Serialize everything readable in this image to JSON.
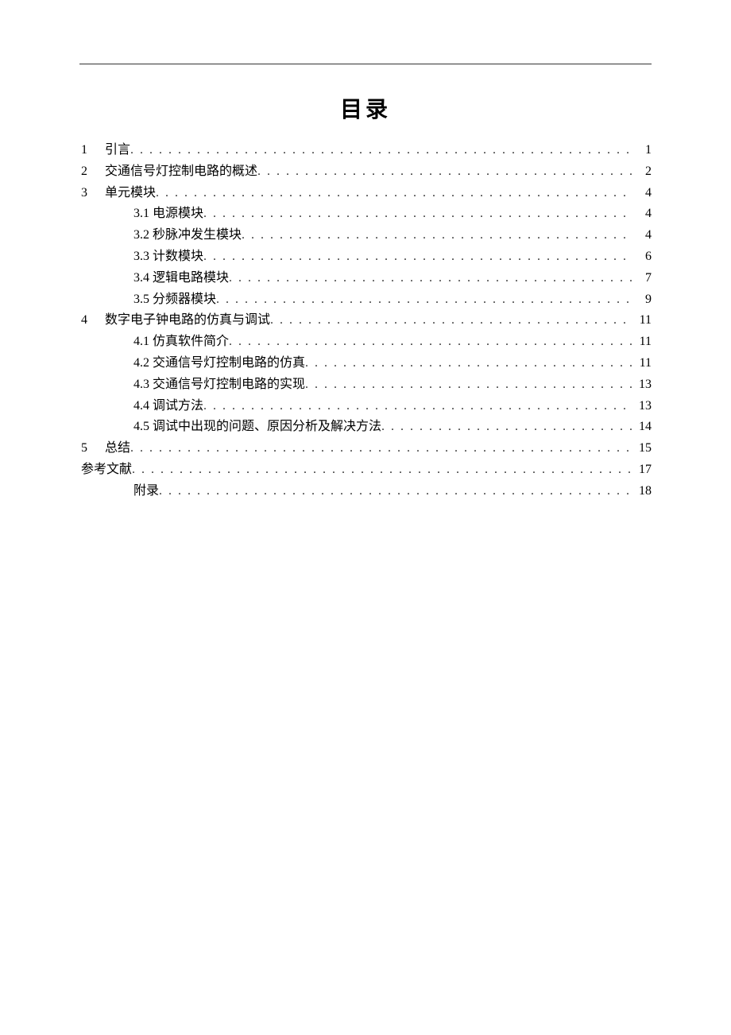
{
  "title": "目录",
  "toc": [
    {
      "num": "1",
      "label": "引言",
      "page": "1",
      "level": 1
    },
    {
      "num": "2",
      "label": "交通信号灯控制电路的概述",
      "page": "2",
      "level": 1
    },
    {
      "num": "3",
      "label": "单元模块",
      "page": "4",
      "level": 1
    },
    {
      "num": "",
      "label": "3.1  电源模块",
      "page": "4",
      "level": 2
    },
    {
      "num": "",
      "label": "3.2 秒脉冲发生模块",
      "page": "4",
      "level": 2
    },
    {
      "num": "",
      "label": "3.3 计数模块",
      "page": "6",
      "level": 2
    },
    {
      "num": "",
      "label": "3.4  逻辑电路模块",
      "page": "7",
      "level": 2
    },
    {
      "num": "",
      "label": "3.5  分频器模块",
      "page": "9",
      "level": 2
    },
    {
      "num": "4",
      "label": "数字电子钟电路的仿真与调试",
      "page": "11",
      "level": 1
    },
    {
      "num": "",
      "label": "4.1 仿真软件简介",
      "page": "11",
      "level": 2
    },
    {
      "num": "",
      "label": "4.2 交通信号灯控制电路的仿真",
      "page": "11",
      "level": 2
    },
    {
      "num": "",
      "label": "4.3  交通信号灯控制电路的实现",
      "page": "13",
      "level": 2
    },
    {
      "num": "",
      "label": "4.4 调试方法",
      "page": "13",
      "level": 2
    },
    {
      "num": "",
      "label": "4.5  调试中出现的问题、原因分析及解决方法",
      "page": "14",
      "level": 2
    },
    {
      "num": "5",
      "label": "总结",
      "page": "15",
      "level": 1
    },
    {
      "num": "",
      "label": "参考文献",
      "page": "17",
      "level": 0
    },
    {
      "num": "",
      "label": "附录",
      "page": "18",
      "level": 2
    }
  ]
}
